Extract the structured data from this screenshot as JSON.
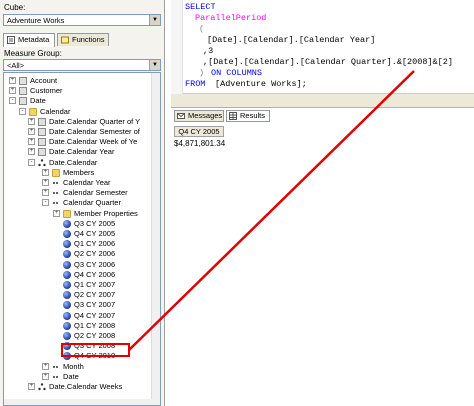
{
  "cube": {
    "label": "Cube:",
    "value": "Adventure Works"
  },
  "tabs": [
    {
      "label": "Metadata"
    },
    {
      "label": "Functions"
    }
  ],
  "measure_group": {
    "label": "Measure Group:",
    "value": "<All>"
  },
  "tree": [
    {
      "text": "Account",
      "level": 1,
      "exp": "+",
      "icon": "dim"
    },
    {
      "text": "Customer",
      "level": 1,
      "exp": "+",
      "icon": "dim"
    },
    {
      "text": "Date",
      "level": 1,
      "exp": "-",
      "icon": "dim"
    },
    {
      "text": "Calendar",
      "level": 2,
      "exp": "-",
      "icon": "folder"
    },
    {
      "text": "Date.Calendar Quarter of Y",
      "level": 3,
      "exp": "+",
      "icon": "dim"
    },
    {
      "text": "Date.Calendar Semester of",
      "level": 3,
      "exp": "+",
      "icon": "dim"
    },
    {
      "text": "Date.Calendar Week of Ye",
      "level": 3,
      "exp": "+",
      "icon": "dim"
    },
    {
      "text": "Date.Calendar Year",
      "level": 3,
      "exp": "+",
      "icon": "dim"
    },
    {
      "text": "Date.Calendar",
      "level": 3,
      "exp": "-",
      "icon": "hier"
    },
    {
      "text": "Members",
      "level": 4,
      "exp": "+",
      "icon": "folder"
    },
    {
      "text": "Calendar Year",
      "level": 4,
      "exp": "+",
      "icon": "lvl"
    },
    {
      "text": "Calendar Semester",
      "level": 4,
      "exp": "+",
      "icon": "lvl"
    },
    {
      "text": "Calendar Quarter",
      "level": 4,
      "exp": "-",
      "icon": "lvl"
    },
    {
      "text": "Member Properties",
      "level": 5,
      "exp": "+",
      "icon": "folder"
    },
    {
      "text": "Q3 CY 2005",
      "level": 5,
      "icon": "ball"
    },
    {
      "text": "Q4 CY 2005",
      "level": 5,
      "icon": "ball"
    },
    {
      "text": "Q1 CY 2006",
      "level": 5,
      "icon": "ball"
    },
    {
      "text": "Q2 CY 2006",
      "level": 5,
      "icon": "ball"
    },
    {
      "text": "Q3 CY 2006",
      "level": 5,
      "icon": "ball"
    },
    {
      "text": "Q4 CY 2006",
      "level": 5,
      "icon": "ball"
    },
    {
      "text": "Q1 CY 2007",
      "level": 5,
      "icon": "ball"
    },
    {
      "text": "Q2 CY 2007",
      "level": 5,
      "icon": "ball"
    },
    {
      "text": "Q3 CY 2007",
      "level": 5,
      "icon": "ball"
    },
    {
      "text": "Q4 CY 2007",
      "level": 5,
      "icon": "ball"
    },
    {
      "text": "Q1 CY 2008",
      "level": 5,
      "icon": "ball"
    },
    {
      "text": "Q2 CY 2008",
      "level": 5,
      "icon": "ball"
    },
    {
      "text": "Q3 CY 2008",
      "level": 5,
      "icon": "ball"
    },
    {
      "text": "Q4 CY 2010",
      "level": 5,
      "icon": "ball"
    },
    {
      "text": "Month",
      "level": 4,
      "exp": "+",
      "icon": "lvl"
    },
    {
      "text": "Date",
      "level": 4,
      "exp": "+",
      "icon": "lvl"
    },
    {
      "text": "Date.Calendar Weeks",
      "level": 3,
      "exp": "+",
      "icon": "hier"
    }
  ],
  "query": {
    "l1": "SELECT",
    "l2": "ParallelPeriod",
    "l3": "(",
    "l4": "[Date].[Calendar].[Calendar Year]",
    "l5": ",3",
    "l6": ",[Date].[Calendar].[Calendar Quarter].&[2008]&[2]",
    "l7a": ")",
    "l7b": "ON COLUMNS",
    "l8a": "FROM",
    "l8b": "[Adventure Works];"
  },
  "result_tabs": [
    {
      "label": "Messages"
    },
    {
      "label": "Results"
    }
  ],
  "result": {
    "column_header": "Q4 CY 2005",
    "value": "$4,871,801.34"
  },
  "colors": {
    "highlight": "#e00000",
    "keyword": "#0000ff",
    "function": "#ff00ff"
  }
}
